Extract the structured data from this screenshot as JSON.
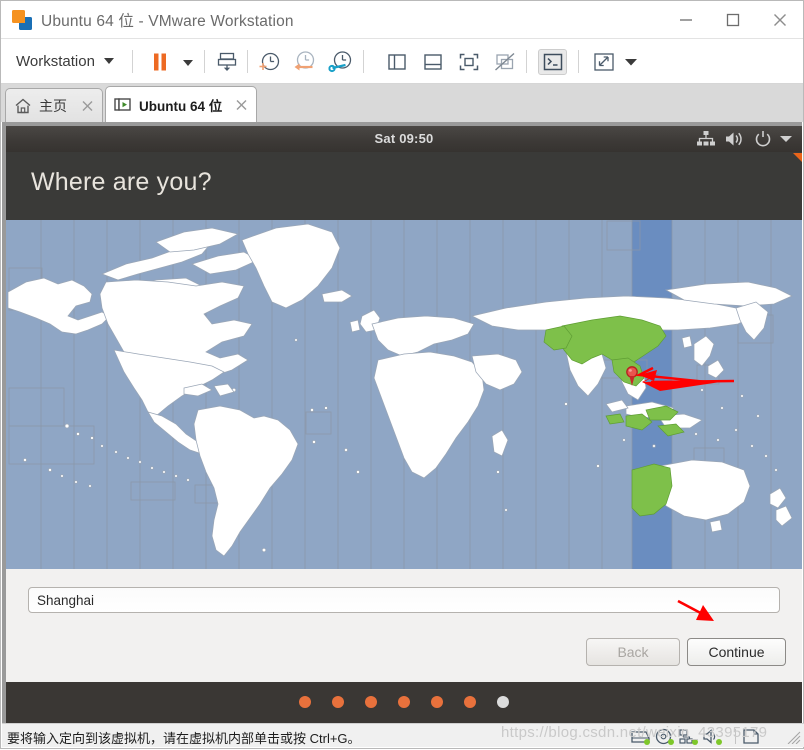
{
  "window": {
    "title": "Ubuntu 64 位 - VMware Workstation",
    "logo_icon": "vmware-logo-icon",
    "controls": {
      "minimize": "minimize-icon",
      "maximize": "maximize-icon",
      "close": "close-icon"
    }
  },
  "toolbar": {
    "menu_label": "Workstation",
    "menu_caret": "chevron-down-icon",
    "items": [
      {
        "name": "pause-vm-button",
        "icon": "pause-icon"
      },
      {
        "name": "pause-dropdown-button",
        "icon": "chevron-down-icon"
      },
      {
        "name": "manage-snapshots-button",
        "icon": "snapshot-manager-icon"
      },
      {
        "name": "take-snapshot-button",
        "icon": "snapshot-add-clock-icon"
      },
      {
        "name": "revert-snapshot-button",
        "icon": "snapshot-revert-clock-icon"
      },
      {
        "name": "snapshot-manager-button",
        "icon": "snapshot-wrench-clock-icon"
      },
      {
        "name": "show-sidebar-button",
        "icon": "panel-left-icon"
      },
      {
        "name": "show-thumbnail-bar-button",
        "icon": "panel-bottom-icon"
      },
      {
        "name": "full-screen-button",
        "icon": "fullscreen-brackets-icon"
      },
      {
        "name": "unity-mode-button",
        "icon": "unity-mode-disabled-icon"
      },
      {
        "name": "console-view-button",
        "icon": "terminal-prompt-icon"
      },
      {
        "name": "stretch-guest-button",
        "icon": "expand-diagonal-icon"
      },
      {
        "name": "stretch-dropdown-button",
        "icon": "chevron-down-icon"
      }
    ]
  },
  "tabs": [
    {
      "name": "tab-home",
      "label": "主页",
      "icon": "home-icon",
      "close_icon": "close-icon",
      "active": false
    },
    {
      "name": "tab-ubuntu",
      "label": "Ubuntu 64 位",
      "icon": "vm-running-icon",
      "close_icon": "close-icon",
      "active": true
    }
  ],
  "guest": {
    "panel": {
      "clock": "Sat 09:50",
      "indicators": [
        {
          "name": "network-indicator",
          "icon": "network-icon"
        },
        {
          "name": "sound-indicator",
          "icon": "volume-icon"
        },
        {
          "name": "power-indicator",
          "icon": "power-icon"
        },
        {
          "name": "session-menu-indicator",
          "icon": "chevron-down-icon"
        }
      ]
    },
    "installer": {
      "heading": "Where are you?",
      "city_value": "Shanghai",
      "city_placeholder": "",
      "back_label": "Back",
      "continue_label": "Continue",
      "step_dots": {
        "total": 7,
        "current_index": 6,
        "done_color": "#e8713c",
        "pending_color": "#dcdcdc"
      }
    },
    "map": {
      "type": "timezone-map",
      "ocean_color": "#8fa6c5",
      "land_color": "#ffffff",
      "highlight_land_color": "#7ec04a",
      "highlight_band_color": "#6a8dc0",
      "border_color": "#8b97a8",
      "marker": {
        "name": "location-marker-pin",
        "label": "Shanghai",
        "color": "#e03030"
      },
      "selected_timezone": "Asia/Shanghai"
    }
  },
  "annotations": [
    {
      "name": "arrow-to-location-marker",
      "color": "#ff0000"
    },
    {
      "name": "arrow-to-continue-button",
      "color": "#ff0000"
    }
  ],
  "statusbar": {
    "message": "要将输入定向到该虚拟机，请在虚拟机内部单击或按 Ctrl+G。",
    "devices": [
      {
        "name": "hard-disk-status-icon",
        "icon": "hdd-icon"
      },
      {
        "name": "cd-dvd-status-icon",
        "icon": "disc-icon"
      },
      {
        "name": "network-adapter-status-icon",
        "icon": "network-icon"
      },
      {
        "name": "sound-card-status-icon",
        "icon": "speaker-icon"
      },
      {
        "name": "usb-status-icon",
        "icon": "usb-device-icon"
      }
    ],
    "resize_grip": "resize-grip-icon"
  },
  "watermark": "https://blog.csdn.net/weixin_43395179"
}
